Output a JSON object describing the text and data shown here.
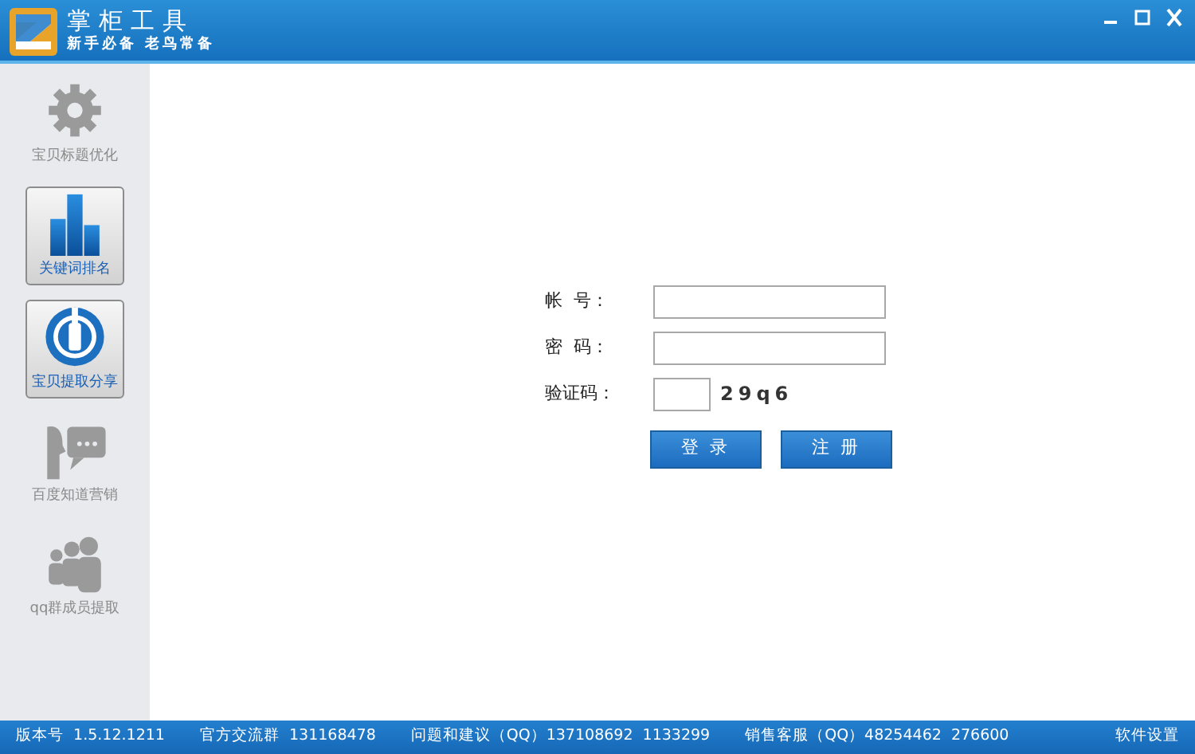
{
  "window": {
    "title": "掌柜工具",
    "subtitle": "新手必备  老鸟常备"
  },
  "sidebar": {
    "items": [
      {
        "label": "宝贝标题优化",
        "kind": "gear",
        "disabled": true
      },
      {
        "label": "关键词排名",
        "kind": "chart",
        "disabled": false
      },
      {
        "label": "宝贝提取分享",
        "kind": "power",
        "disabled": false
      },
      {
        "label": "百度知道营销",
        "kind": "talk",
        "disabled": true
      },
      {
        "label": "qq群成员提取",
        "kind": "group",
        "disabled": true
      }
    ]
  },
  "login": {
    "fields": [
      {
        "label": "帐  号：",
        "kind": "text"
      },
      {
        "label": "密  码：",
        "kind": "password"
      },
      {
        "label": "验证码：",
        "kind": "captcha",
        "captcha": "29q6"
      }
    ],
    "buttons": [
      "登 录",
      "注 册"
    ]
  },
  "status_bar": {
    "items": [
      "版本号  1.5.12.1211",
      "官方交流群  131168478",
      "问题和建议（QQ）137108692  1133299",
      "销售客服（QQ）48254462  276600"
    ],
    "settings": "软件设置"
  }
}
